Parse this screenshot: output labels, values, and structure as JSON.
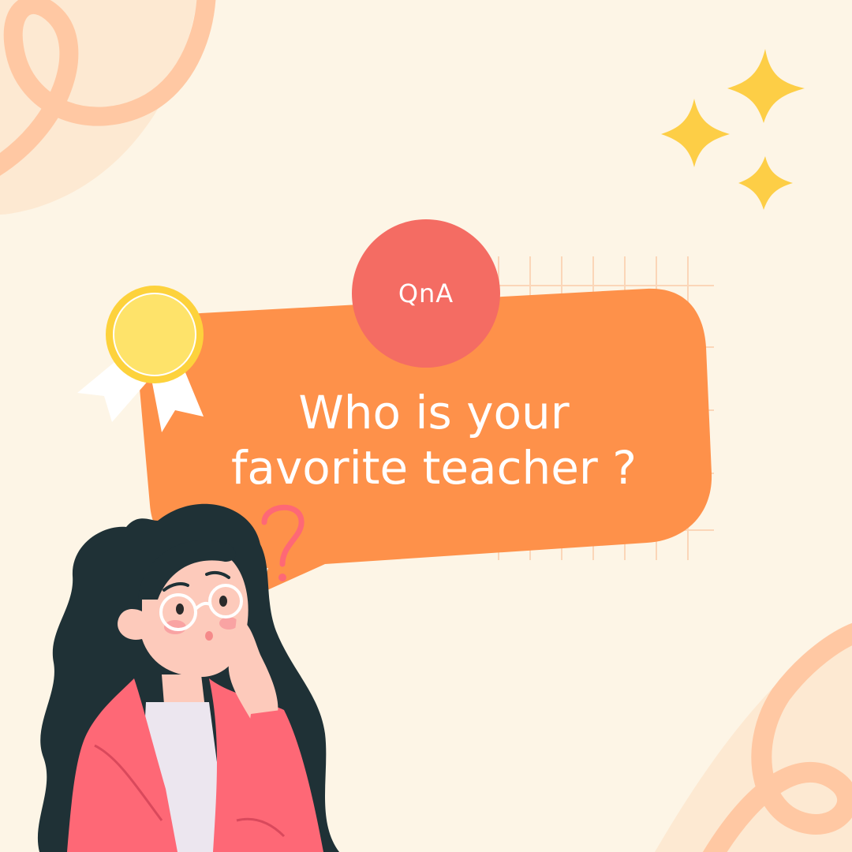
{
  "badge": {
    "label": "QnA"
  },
  "question": {
    "line1": "Who is your",
    "line2": "favorite teacher ?"
  },
  "colors": {
    "background": "#fdf5e6",
    "bubble": "#fe914a",
    "badge": "#f46c63",
    "medal": "#fede5b",
    "sparkle": "#fdce46",
    "swirl": "#ffc8a3",
    "hair": "#1f3136",
    "jacket": "#fe6876",
    "skin": "#fdcabb",
    "question_mark": "#fe6876"
  },
  "icons": [
    "sparkle-icon",
    "medal-icon",
    "question-mark-icon",
    "thinking-woman-illustration"
  ]
}
